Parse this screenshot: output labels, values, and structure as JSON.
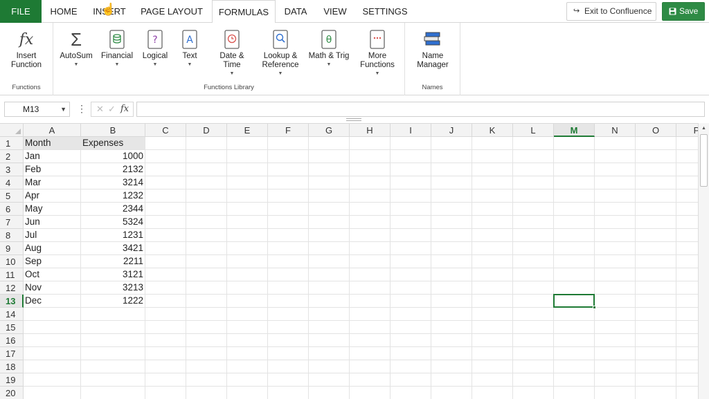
{
  "tabs": [
    "FILE",
    "HOME",
    "INSERT",
    "PAGE LAYOUT",
    "FORMULAS",
    "DATA",
    "VIEW",
    "SETTINGS"
  ],
  "active_tab": "FORMULAS",
  "exit_label": "Exit to Confluence",
  "save_label": "Save",
  "ribbon": {
    "groups": [
      "Functions",
      "Functions Library",
      "Names"
    ],
    "buttons": {
      "insert_function": "Insert Function",
      "autosum": "AutoSum",
      "financial": "Financial",
      "logical": "Logical",
      "text": "Text",
      "date_time": "Date & Time",
      "lookup": "Lookup & Reference",
      "math": "Math & Trig",
      "more": "More Functions",
      "name_manager": "Name Manager"
    }
  },
  "formula_bar": {
    "name_box": "M13",
    "formula": ""
  },
  "sheet": {
    "columns": [
      "A",
      "B",
      "C",
      "D",
      "E",
      "F",
      "G",
      "H",
      "I",
      "J",
      "K",
      "L",
      "M",
      "N",
      "O",
      "P"
    ],
    "selected_column": "M",
    "selected_row": 13,
    "row_count": 20,
    "headers": [
      "Month",
      "Expenses"
    ],
    "rows": [
      [
        "Jan",
        1000
      ],
      [
        "Feb",
        2132
      ],
      [
        "Mar",
        3214
      ],
      [
        "Apr",
        1232
      ],
      [
        "May",
        2344
      ],
      [
        "Jun",
        5324
      ],
      [
        "Jul",
        1231
      ],
      [
        "Aug",
        3421
      ],
      [
        "Sep",
        2211
      ],
      [
        "Oct",
        3121
      ],
      [
        "Nov",
        3213
      ],
      [
        "Dec",
        1222
      ]
    ]
  },
  "colors": {
    "accent_green": "#1e7a34",
    "save_green": "#2e8b45"
  }
}
